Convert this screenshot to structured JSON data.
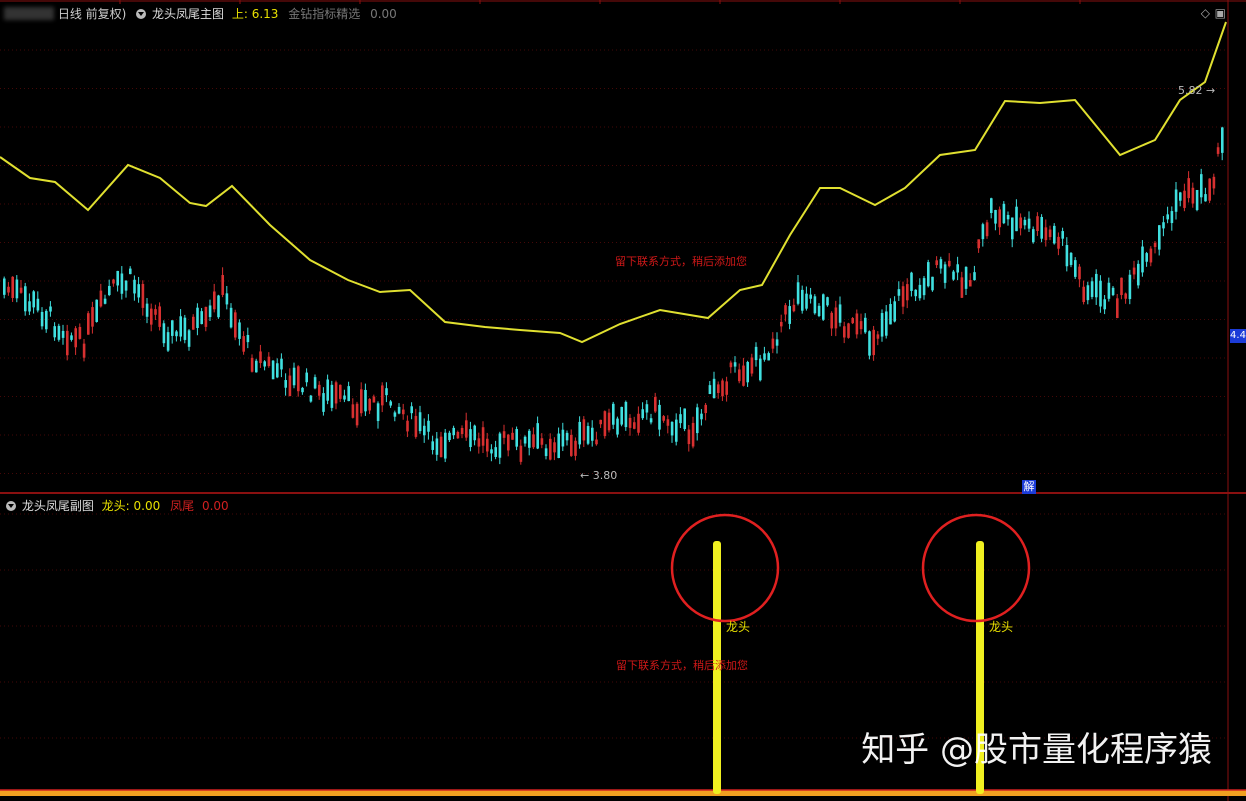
{
  "colors": {
    "background": "#000000",
    "grid": "#8a1010",
    "up_candle": "#d83030",
    "down_candle": "#40e0e0",
    "ma_line": "#e0e030",
    "signal_bar": "#f0f020",
    "circle": "#e02020",
    "note": "#d01818"
  },
  "main_panel": {
    "title_prefix": "日线 前复权)",
    "indicator_name": "龙头凤尾主图",
    "upper_label": "上:",
    "upper_value": "6.13",
    "secondary_label": "金钻指标精选",
    "secondary_value": "0.00",
    "low_price_label": "3.80",
    "high_price_label": "5.82",
    "right_badge": "4.4",
    "badge_jie": "解",
    "contact_note": "留下联系方式，稍后添加您",
    "controls": {
      "diamond_icon": "◇",
      "window_icon": "▣"
    }
  },
  "sub_panel": {
    "indicator_name": "龙头凤尾副图",
    "dragon_label": "龙头:",
    "dragon_value": "0.00",
    "phoenix_label": "凤尾",
    "phoenix_value": "0.00",
    "contact_note": "留下联系方式，稍后添加您",
    "signals": [
      {
        "label": "龙头"
      },
      {
        "label": "龙头"
      }
    ]
  },
  "watermark": "知乎 @股市量化程序猿"
}
